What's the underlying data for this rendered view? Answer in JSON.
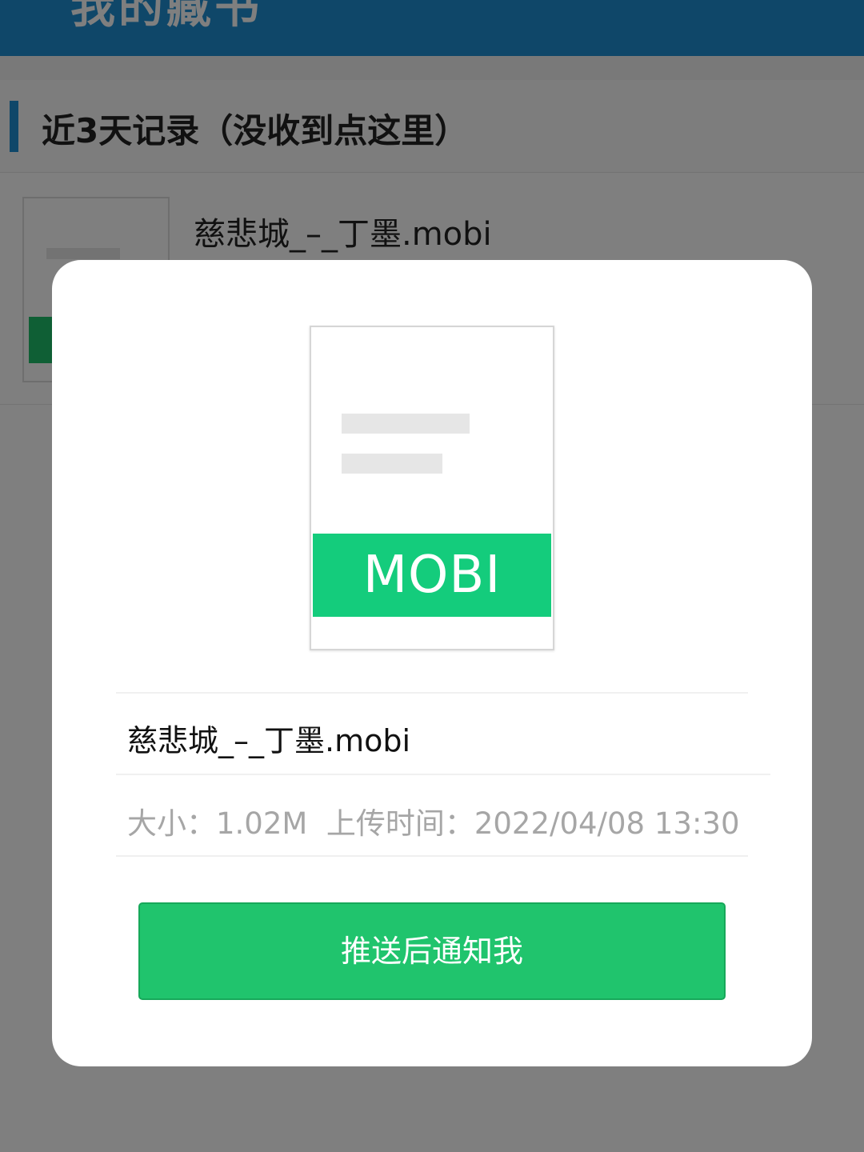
{
  "header": {
    "title": "我的藏书"
  },
  "section": {
    "title": "近3天记录（没收到点这里）"
  },
  "file_row": {
    "name": "慈悲城_–_丁墨.mobi"
  },
  "modal": {
    "file_type_label": "MOBI",
    "file_name": "慈悲城_–_丁墨.mobi",
    "size_label": "大小：",
    "size_value": "1.02M",
    "upload_time_label": "上传时间：",
    "upload_time_value": "2022/04/08 13:30",
    "push_button_label": "推送后通知我"
  },
  "colors": {
    "header_blue": "#1f8fd3",
    "mobi_green": "#14cc7c",
    "button_green": "#20c46d",
    "meta_gray": "#a6a6a6"
  },
  "icons": {
    "file_thumbnail": "document-icon",
    "modal_file": "mobi-file-icon"
  }
}
